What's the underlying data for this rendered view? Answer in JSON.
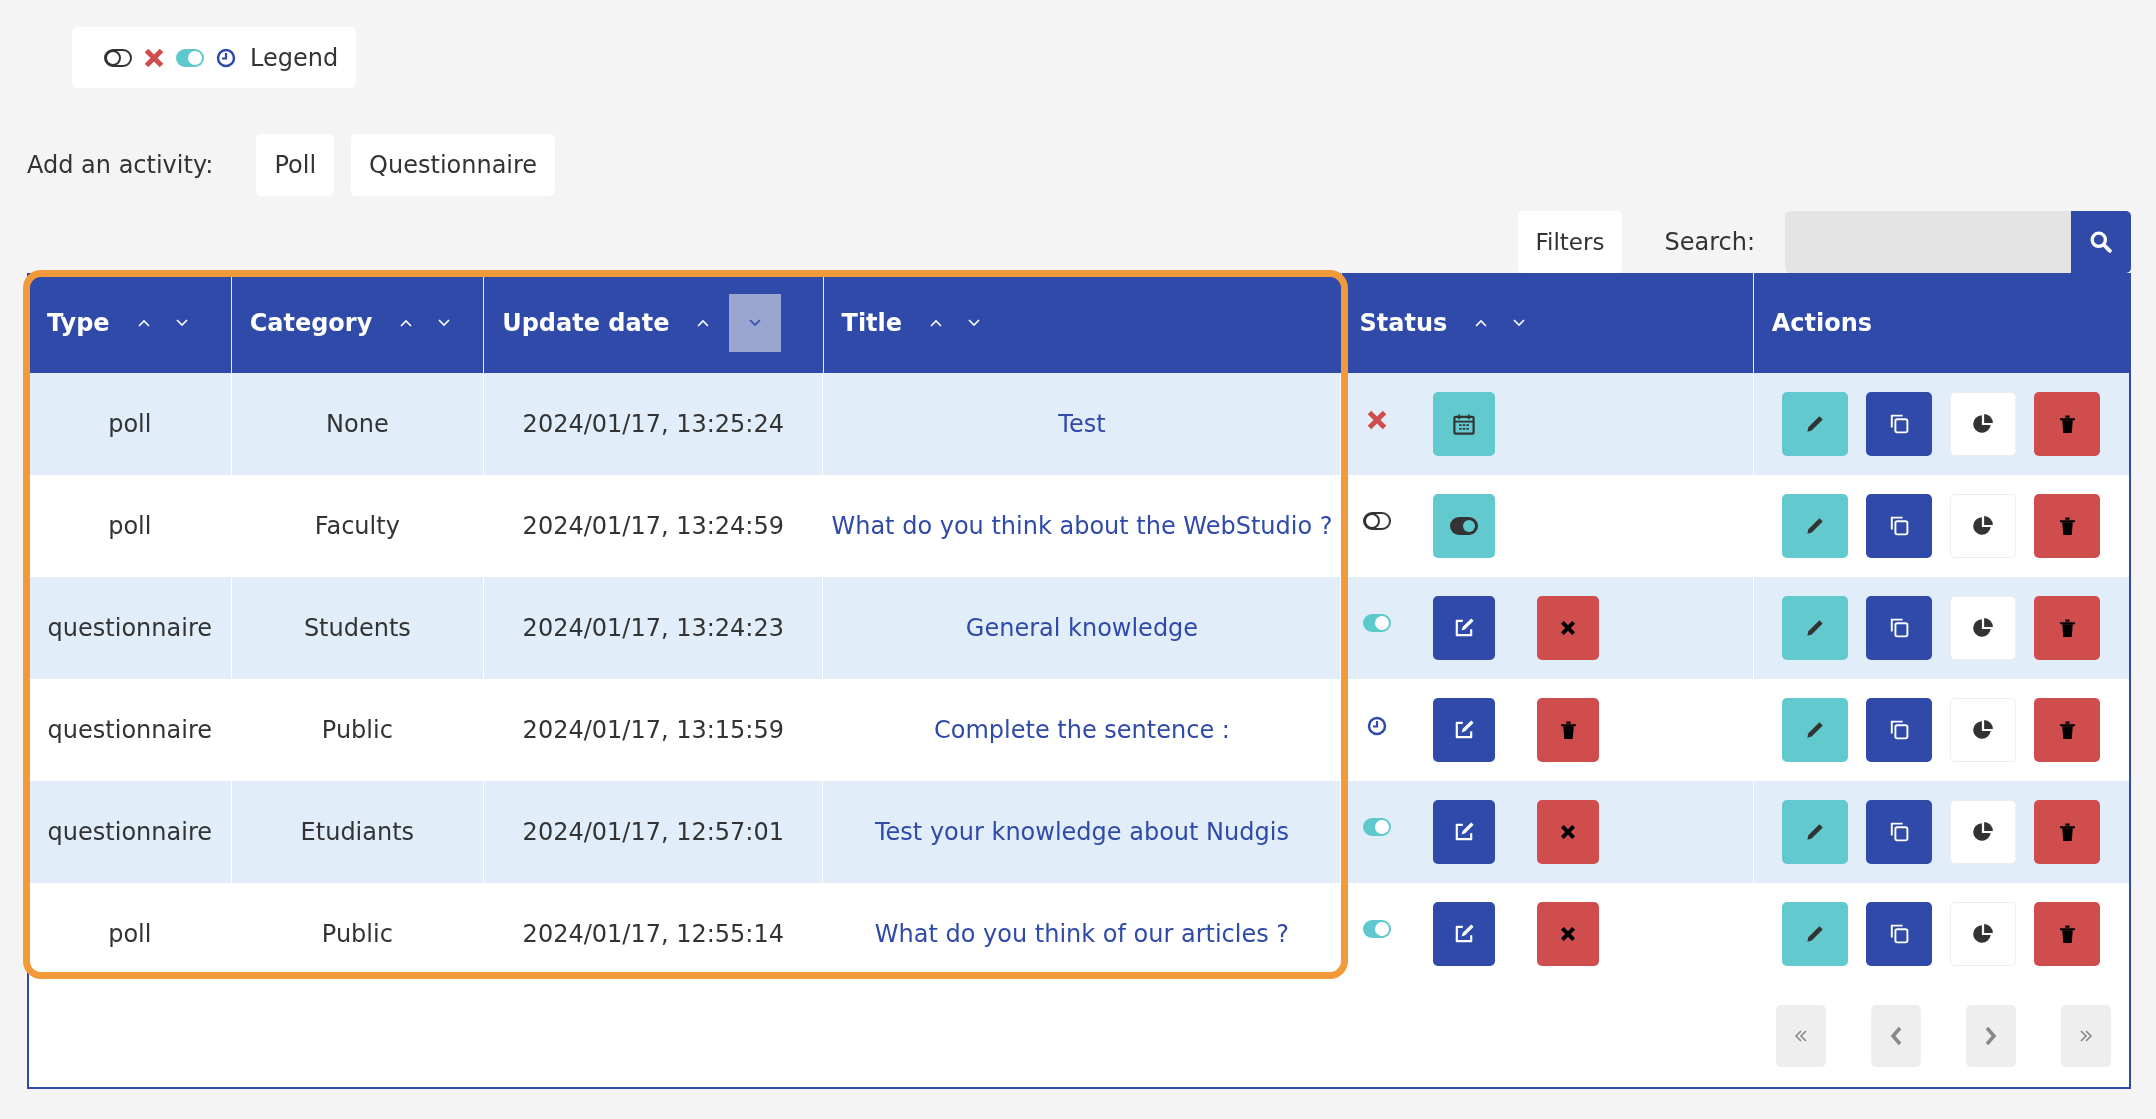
{
  "legend": {
    "label": "Legend",
    "icons": [
      {
        "kind": "off"
      },
      {
        "kind": "cross"
      },
      {
        "kind": "on"
      },
      {
        "kind": "clock"
      }
    ]
  },
  "add_activity": {
    "label": "Add an activity:",
    "buttons": [
      "Poll",
      "Questionnaire"
    ]
  },
  "toolbar": {
    "filters": "Filters",
    "search_label": "Search:"
  },
  "table": {
    "columns": [
      {
        "label": "Type",
        "sortable": true,
        "sorted_desc": false
      },
      {
        "label": "Category",
        "sortable": true,
        "sorted_desc": false
      },
      {
        "label": "Update date",
        "sortable": true,
        "sorted_desc": true
      },
      {
        "label": "Title",
        "sortable": true,
        "sorted_desc": false
      },
      {
        "label": "Status",
        "sortable": true,
        "sorted_desc": false
      },
      {
        "label": "Actions",
        "sortable": false
      }
    ],
    "rows": [
      {
        "type": "poll",
        "category": "None",
        "date": "2024/01/17, 13:25:24",
        "title": "Test",
        "status": {
          "kind": "cross"
        },
        "status_buttons": [
          {
            "kind": "calendar"
          }
        ]
      },
      {
        "type": "poll",
        "category": "Faculty",
        "date": "2024/01/17, 13:24:59",
        "title": "What do you think about the WebStudio ?",
        "status": {
          "kind": "off"
        },
        "status_buttons": [
          {
            "kind": "toggle"
          }
        ]
      },
      {
        "type": "questionnaire",
        "category": "Students",
        "date": "2024/01/17, 13:24:23",
        "title": "General knowledge",
        "status": {
          "kind": "on"
        },
        "status_buttons": [
          {
            "kind": "edit"
          },
          {
            "kind": "cancel"
          }
        ]
      },
      {
        "type": "questionnaire",
        "category": "Public",
        "date": "2024/01/17, 13:15:59",
        "title": "Complete the sentence :",
        "status": {
          "kind": "clock"
        },
        "status_buttons": [
          {
            "kind": "edit"
          },
          {
            "kind": "delete"
          }
        ]
      },
      {
        "type": "questionnaire",
        "category": "Etudiants",
        "date": "2024/01/17, 12:57:01",
        "title": "Test your knowledge about Nudgis",
        "status": {
          "kind": "on"
        },
        "status_buttons": [
          {
            "kind": "edit"
          },
          {
            "kind": "cancel"
          }
        ]
      },
      {
        "type": "poll",
        "category": "Public",
        "date": "2024/01/17, 12:55:14",
        "title": "What do you think of our articles ?",
        "status": {
          "kind": "on"
        },
        "status_buttons": [
          {
            "kind": "edit"
          },
          {
            "kind": "cancel"
          }
        ]
      }
    ]
  }
}
